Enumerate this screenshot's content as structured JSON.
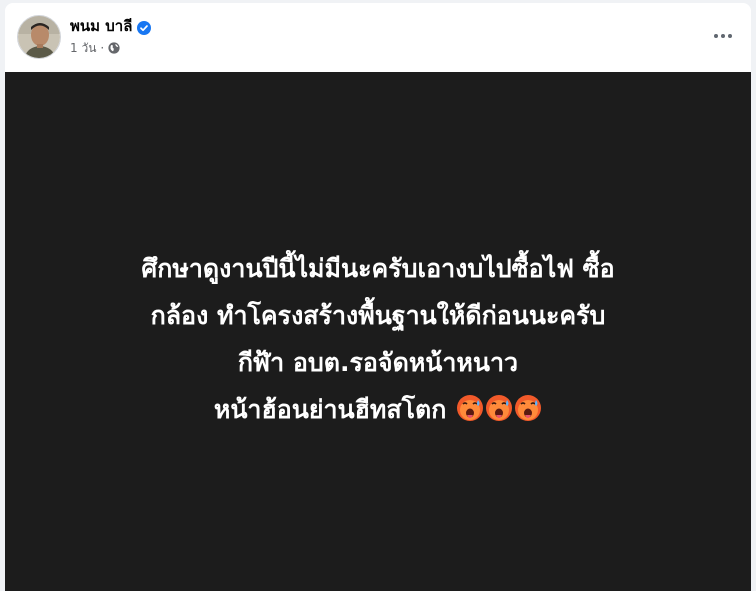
{
  "post": {
    "author": {
      "name": "พนม บาลี",
      "verified": true
    },
    "meta": {
      "time": "1 วัน",
      "separator": "·",
      "audience_icon": "globe-icon"
    },
    "more_icon": "more-options-icon",
    "content": {
      "background_color": "#1c1c1c",
      "text_color": "#ffffff",
      "lines": [
        "ศึกษาดูงานปีนี้ไม่มีนะครับเอางบไปซื้อไฟ ซื้อ",
        "กล้อง ทำโครงสร้างพื้นฐานให้ดีก่อนนะครับ",
        "กีฬ้า อบต.รอจัดหน้าหนาว",
        "หน้าฮ้อนย่านฮีทสโตก"
      ],
      "emoji": [
        "hot-face-emoji",
        "hot-face-emoji",
        "hot-face-emoji"
      ]
    }
  }
}
